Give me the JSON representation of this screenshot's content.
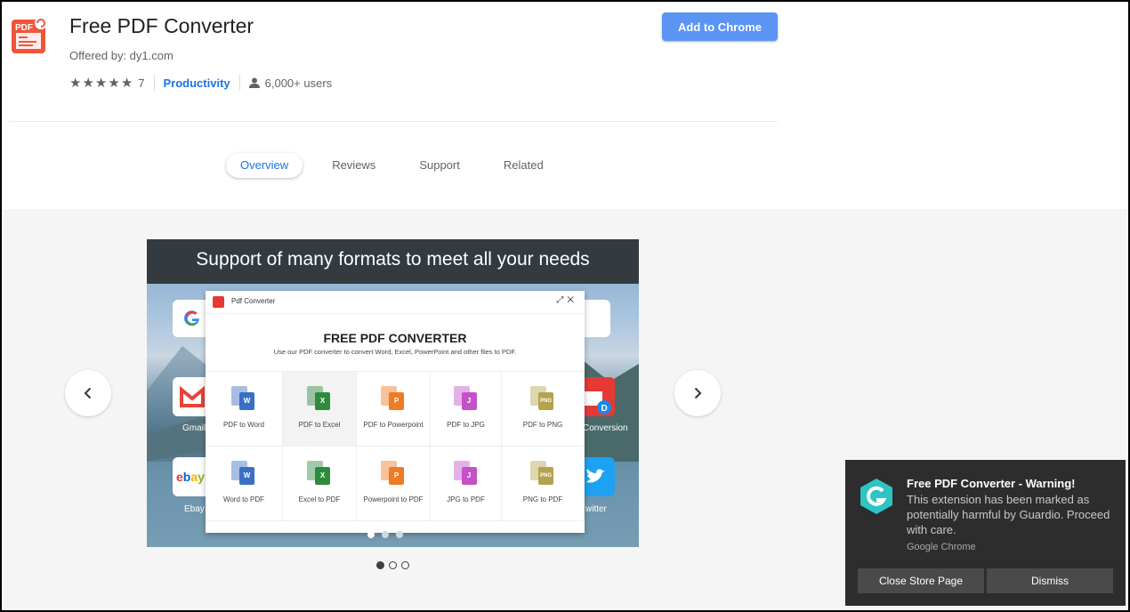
{
  "extension": {
    "title": "Free PDF Converter",
    "offered_by": "Offered by: dy1.com",
    "rating_count": "7",
    "category": "Productivity",
    "users": "6,000+ users",
    "add_button": "Add to Chrome"
  },
  "tabs": [
    {
      "label": "Overview",
      "active": true
    },
    {
      "label": "Reviews"
    },
    {
      "label": "Support"
    },
    {
      "label": "Related"
    }
  ],
  "gallery": {
    "slide_banner": "Support of many formats to meet all your needs",
    "popup_title": "Pdf Converter",
    "popup_heading": "FREE PDF CONVERTER",
    "popup_subtitle": "Use our PDF converter to convert Word, Excel, PowerPoint and other files to PDF.",
    "tiles": {
      "gmail": "Gmail",
      "ebay": "Ebay",
      "conversion": "Conversion",
      "twitter": "witter"
    },
    "conversions": [
      {
        "label": "PDF to Word",
        "badge": "W",
        "color": "#3b6fc4"
      },
      {
        "label": "PDF to Excel",
        "badge": "X",
        "color": "#2e8b3e"
      },
      {
        "label": "PDF to Powerpoint",
        "badge": "P",
        "color": "#ef7b22"
      },
      {
        "label": "PDF to JPG",
        "badge": "J",
        "color": "#c451c9"
      },
      {
        "label": "PDF to PNG",
        "badge": "PNG",
        "color": "#b4a34c"
      },
      {
        "label": "Word to PDF",
        "badge": "W",
        "color": "#3b6fc4"
      },
      {
        "label": "Excel to PDF",
        "badge": "X",
        "color": "#2e8b3e"
      },
      {
        "label": "Powerpoint to PDF",
        "badge": "P",
        "color": "#ef7b22"
      },
      {
        "label": "JPG to PDF",
        "badge": "J",
        "color": "#c451c9"
      },
      {
        "label": "PNG to PDF",
        "badge": "PNG",
        "color": "#b4a34c"
      }
    ],
    "page_count": 3,
    "current_page": 1
  },
  "toast": {
    "title": "Free PDF Converter - Warning!",
    "message": "This extension has been marked as potentially harmful by Guardio. Proceed with care.",
    "source": "Google Chrome",
    "close_button": "Close Store Page",
    "dismiss_button": "Dismiss"
  },
  "colors": {
    "accent": "#1a73e8",
    "add_button": "#5a95f5",
    "pdf_red": "#e53935",
    "guardio_teal": "#2ec4c4",
    "toast_bg": "#2d2d2d"
  },
  "icons": [
    "pdf-logo-icon",
    "star-icon",
    "user-icon",
    "chevron-left-icon",
    "chevron-right-icon",
    "google-icon",
    "gmail-icon",
    "ebay-icon",
    "twitter-icon",
    "guardio-logo-icon",
    "expand-icon",
    "close-icon"
  ]
}
